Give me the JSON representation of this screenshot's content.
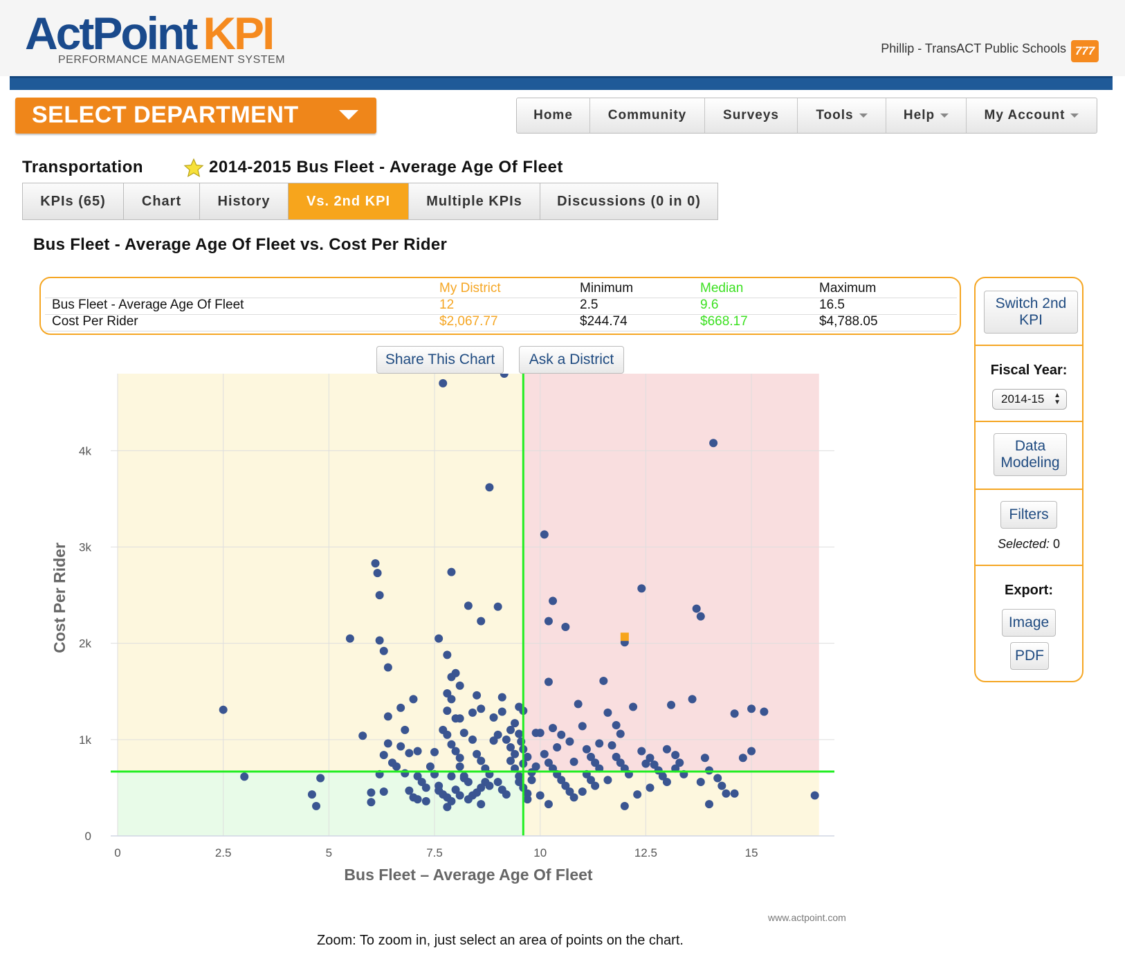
{
  "header": {
    "logo_brand": "ActPoint",
    "logo_product": "KPI",
    "logo_tagline": "PERFORMANCE MANAGEMENT SYSTEM",
    "user_text": "Phillip - TransACT Public Schools",
    "badge_count": "777"
  },
  "department_button": {
    "label": "SELECT DEPARTMENT"
  },
  "topnav": [
    {
      "label": "Home",
      "dropdown": false
    },
    {
      "label": "Community",
      "dropdown": false
    },
    {
      "label": "Surveys",
      "dropdown": false
    },
    {
      "label": "Tools",
      "dropdown": true
    },
    {
      "label": "Help",
      "dropdown": true
    },
    {
      "label": "My Account",
      "dropdown": true
    }
  ],
  "page": {
    "department": "Transportation",
    "kpi_title": "2014-2015 Bus Fleet - Average Age Of Fleet",
    "chart_heading": "Bus Fleet - Average Age Of Fleet vs. Cost Per Rider"
  },
  "subtabs": [
    {
      "label": "KPIs (65)",
      "active": false
    },
    {
      "label": "Chart",
      "active": false
    },
    {
      "label": "History",
      "active": false
    },
    {
      "label": "Vs. 2nd KPI",
      "active": true
    },
    {
      "label": "Multiple KPIs",
      "active": false
    },
    {
      "label": "Discussions (0 in 0)",
      "active": false
    }
  ],
  "stats": {
    "headers": [
      "My District",
      "Minimum",
      "Median",
      "Maximum"
    ],
    "rows": [
      {
        "label": "Bus Fleet - Average Age Of Fleet",
        "values": [
          "12",
          "2.5",
          "9.6",
          "16.5"
        ]
      },
      {
        "label": "Cost Per Rider",
        "values": [
          "$2,067.77",
          "$244.74",
          "$668.17",
          "$4,788.05"
        ]
      }
    ]
  },
  "actions": {
    "share": "Share This Chart",
    "ask": "Ask a District"
  },
  "side_panel": {
    "switch_label": "Switch 2nd KPI",
    "switch_line1": "Switch 2nd",
    "switch_line2": "KPI",
    "fiscal_year_label": "Fiscal Year:",
    "fiscal_year_value": "2014-15",
    "data_modeling_line1": "Data",
    "data_modeling_line2": "Modeling",
    "filters_label": "Filters",
    "selected_label": "Selected",
    "selected_value": "0",
    "export_label": "Export:",
    "export_image": "Image",
    "export_pdf": "PDF"
  },
  "footer": {
    "zoom_note": "Zoom: To zoom in, just select an area of points on the chart.",
    "watermark": "www.actpoint.com"
  },
  "colors": {
    "accent_orange": "#f5a623",
    "brand_blue": "#1f5a98",
    "median_green": "#22ee22",
    "point_blue": "#3a5591",
    "my_district_orange": "#f7a51c",
    "quadrant_yellow": "#fdf7de",
    "quadrant_red": "#f9dedf",
    "quadrant_green": "#e8fbe8"
  },
  "icons": {
    "favorite": "star-icon",
    "dropdown": "chevron-down-icon"
  },
  "chart_data": {
    "type": "scatter",
    "xlabel": "Bus Fleet – Average Age Of Fleet",
    "ylabel": "Cost Per Rider",
    "xlim": [
      0,
      16.8
    ],
    "ylim": [
      0,
      4800
    ],
    "x_ticks": [
      0,
      2.5,
      5,
      7.5,
      10,
      12.5,
      15
    ],
    "x_tick_labels": [
      "0",
      "2.5",
      "5",
      "7.5",
      "10",
      "12.5",
      "15"
    ],
    "y_ticks": [
      0,
      1000,
      2000,
      3000,
      4000
    ],
    "y_tick_labels": [
      "0",
      "1k",
      "2k",
      "3k",
      "4k"
    ],
    "grid": true,
    "median_x": 9.6,
    "median_y": 668.17,
    "my_district": {
      "x": 12,
      "y": 2067.77
    },
    "points": [
      [
        2.5,
        1310
      ],
      [
        3.0,
        615
      ],
      [
        4.6,
        430
      ],
      [
        4.7,
        310
      ],
      [
        4.8,
        600
      ],
      [
        5.5,
        2050
      ],
      [
        5.8,
        1040
      ],
      [
        6.1,
        2830
      ],
      [
        6.15,
        2730
      ],
      [
        6.2,
        2500
      ],
      [
        6.2,
        2030
      ],
      [
        6.3,
        1920
      ],
      [
        6.4,
        1750
      ],
      [
        6.4,
        1240
      ],
      [
        6.4,
        960
      ],
      [
        6.3,
        840
      ],
      [
        6.2,
        640
      ],
      [
        6.3,
        460
      ],
      [
        6.0,
        450
      ],
      [
        6.0,
        350
      ],
      [
        6.5,
        760
      ],
      [
        6.6,
        720
      ],
      [
        6.7,
        1330
      ],
      [
        6.8,
        1100
      ],
      [
        6.7,
        930
      ],
      [
        6.9,
        860
      ],
      [
        6.8,
        650
      ],
      [
        6.9,
        470
      ],
      [
        7.0,
        400
      ],
      [
        7.1,
        380
      ],
      [
        7.0,
        1420
      ],
      [
        7.1,
        880
      ],
      [
        7.2,
        560
      ],
      [
        7.1,
        620
      ],
      [
        7.3,
        500
      ],
      [
        7.3,
        360
      ],
      [
        7.4,
        720
      ],
      [
        7.5,
        870
      ],
      [
        7.5,
        640
      ],
      [
        7.6,
        2050
      ],
      [
        7.7,
        1100
      ],
      [
        7.8,
        1480
      ],
      [
        7.9,
        1650
      ],
      [
        7.8,
        1300
      ],
      [
        8.0,
        1220
      ],
      [
        7.9,
        1420
      ],
      [
        8.0,
        1690
      ],
      [
        8.1,
        1560
      ],
      [
        8.1,
        1220
      ],
      [
        8.2,
        1070
      ],
      [
        7.8,
        1880
      ],
      [
        7.9,
        2740
      ],
      [
        7.7,
        4700
      ],
      [
        7.8,
        1050
      ],
      [
        7.9,
        950
      ],
      [
        8.0,
        880
      ],
      [
        8.1,
        810
      ],
      [
        8.1,
        720
      ],
      [
        8.2,
        620
      ],
      [
        8.3,
        560
      ],
      [
        7.6,
        520
      ],
      [
        7.6,
        470
      ],
      [
        7.7,
        430
      ],
      [
        7.8,
        400
      ],
      [
        7.9,
        360
      ],
      [
        7.8,
        300
      ],
      [
        7.9,
        620
      ],
      [
        8.0,
        480
      ],
      [
        8.1,
        420
      ],
      [
        8.2,
        600
      ],
      [
        8.3,
        2390
      ],
      [
        8.6,
        2230
      ],
      [
        8.4,
        1280
      ],
      [
        8.5,
        1460
      ],
      [
        8.6,
        1320
      ],
      [
        8.4,
        1000
      ],
      [
        8.5,
        850
      ],
      [
        8.6,
        780
      ],
      [
        8.7,
        700
      ],
      [
        8.8,
        640
      ],
      [
        8.8,
        3620
      ],
      [
        8.9,
        1230
      ],
      [
        8.9,
        990
      ],
      [
        9.0,
        2380
      ],
      [
        9.1,
        1290
      ],
      [
        9.1,
        1440
      ],
      [
        9.0,
        1050
      ],
      [
        9.2,
        1000
      ],
      [
        9.3,
        920
      ],
      [
        9.4,
        850
      ],
      [
        8.7,
        560
      ],
      [
        8.6,
        500
      ],
      [
        8.5,
        450
      ],
      [
        8.4,
        420
      ],
      [
        8.3,
        380
      ],
      [
        8.6,
        330
      ],
      [
        8.8,
        520
      ],
      [
        9.0,
        560
      ],
      [
        9.1,
        480
      ],
      [
        9.2,
        430
      ],
      [
        9.15,
        4800
      ],
      [
        9.3,
        1100
      ],
      [
        9.4,
        1170
      ],
      [
        9.5,
        1340
      ],
      [
        9.6,
        1300
      ],
      [
        9.5,
        1060
      ],
      [
        9.55,
        980
      ],
      [
        9.6,
        900
      ],
      [
        9.7,
        820
      ],
      [
        9.6,
        750
      ],
      [
        9.3,
        780
      ],
      [
        9.4,
        700
      ],
      [
        9.5,
        620
      ],
      [
        9.5,
        560
      ],
      [
        9.6,
        500
      ],
      [
        9.7,
        440
      ],
      [
        9.7,
        380
      ],
      [
        9.8,
        660
      ],
      [
        9.8,
        580
      ],
      [
        9.9,
        720
      ],
      [
        10.1,
        3130
      ],
      [
        10.3,
        2440
      ],
      [
        10.2,
        2230
      ],
      [
        10.6,
        2170
      ],
      [
        10.2,
        1600
      ],
      [
        10.0,
        1070
      ],
      [
        10.3,
        1120
      ],
      [
        10.5,
        1050
      ],
      [
        10.7,
        980
      ],
      [
        10.4,
        920
      ],
      [
        10.1,
        850
      ],
      [
        10.2,
        760
      ],
      [
        10.3,
        700
      ],
      [
        10.4,
        640
      ],
      [
        10.5,
        580
      ],
      [
        10.6,
        520
      ],
      [
        10.7,
        460
      ],
      [
        10.8,
        400
      ],
      [
        10.2,
        330
      ],
      [
        10.0,
        420
      ],
      [
        10.9,
        1370
      ],
      [
        11.0,
        1140
      ],
      [
        11.1,
        900
      ],
      [
        11.2,
        820
      ],
      [
        11.3,
        760
      ],
      [
        11.4,
        700
      ],
      [
        11.1,
        640
      ],
      [
        11.2,
        580
      ],
      [
        11.3,
        520
      ],
      [
        11.0,
        460
      ],
      [
        11.5,
        1610
      ],
      [
        11.6,
        1280
      ],
      [
        11.8,
        1150
      ],
      [
        11.9,
        1060
      ],
      [
        11.7,
        940
      ],
      [
        11.8,
        820
      ],
      [
        11.9,
        760
      ],
      [
        12.0,
        700
      ],
      [
        12.1,
        640
      ],
      [
        11.6,
        580
      ],
      [
        12.4,
        2570
      ],
      [
        12.2,
        1340
      ],
      [
        12.4,
        880
      ],
      [
        12.6,
        810
      ],
      [
        12.7,
        740
      ],
      [
        12.8,
        680
      ],
      [
        12.9,
        620
      ],
      [
        13.0,
        560
      ],
      [
        12.6,
        500
      ],
      [
        12.3,
        430
      ],
      [
        13.1,
        1360
      ],
      [
        13.0,
        900
      ],
      [
        13.2,
        840
      ],
      [
        13.3,
        760
      ],
      [
        13.2,
        700
      ],
      [
        13.4,
        640
      ],
      [
        13.6,
        1420
      ],
      [
        13.8,
        2280
      ],
      [
        13.7,
        2360
      ],
      [
        13.9,
        810
      ],
      [
        14.1,
        4080
      ],
      [
        14.0,
        680
      ],
      [
        14.2,
        600
      ],
      [
        14.3,
        520
      ],
      [
        14.4,
        440
      ],
      [
        14.6,
        1270
      ],
      [
        14.6,
        440
      ],
      [
        14.8,
        810
      ],
      [
        15.0,
        1320
      ],
      [
        15.0,
        880
      ],
      [
        15.3,
        1290
      ],
      [
        16.5,
        420
      ],
      [
        12.0,
        2010
      ],
      [
        9.9,
        1070
      ],
      [
        10.8,
        770
      ],
      [
        11.4,
        960
      ],
      [
        12.5,
        750
      ],
      [
        13.8,
        560
      ],
      [
        14.0,
        330
      ],
      [
        12.0,
        310
      ]
    ]
  }
}
